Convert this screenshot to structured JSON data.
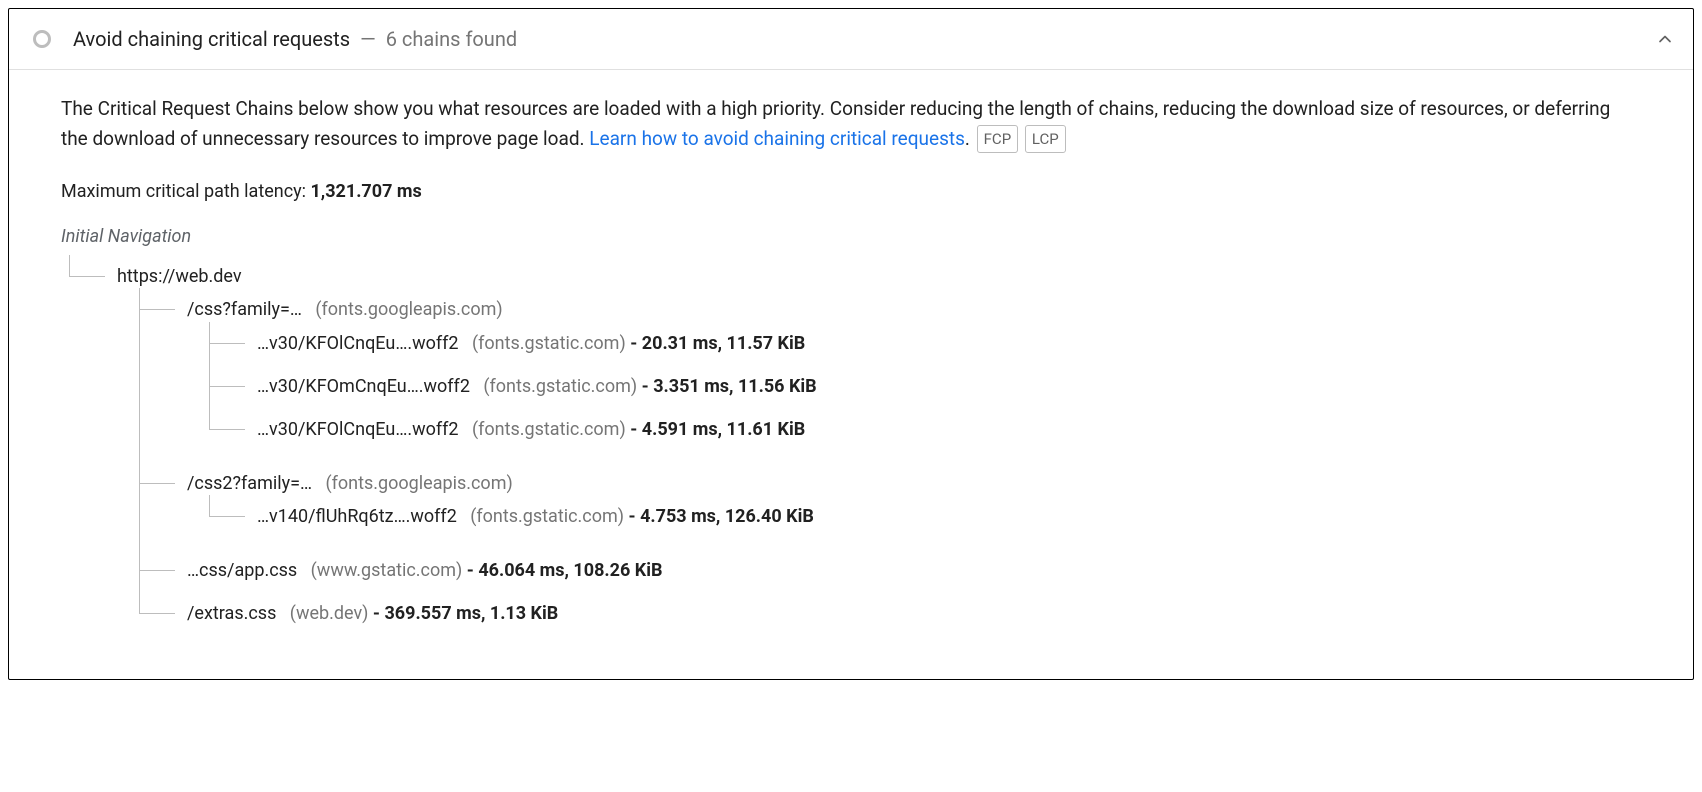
{
  "header": {
    "title": "Avoid chaining critical requests",
    "separator": "—",
    "summary": "6 chains found"
  },
  "description": {
    "text_before_link": "The Critical Request Chains below show you what resources are loaded with a high priority. Consider reducing the length of chains, reducing the download size of resources, or deferring the download of unnecessary resources to improve page load. ",
    "link_text": "Learn how to avoid chaining critical requests",
    "text_after_link": "."
  },
  "badges": [
    "FCP",
    "LCP"
  ],
  "latency": {
    "label": "Maximum critical path latency: ",
    "value": "1,321.707 ms"
  },
  "tree": {
    "root_label": "Initial Navigation",
    "nodes": {
      "n0": {
        "path": "https://web.dev",
        "host": "",
        "stats": ""
      },
      "n1": {
        "path": "/css?family=…",
        "host": "(fonts.googleapis.com)",
        "stats": ""
      },
      "n1a": {
        "path": "…v30/KFOlCnqEu….woff2",
        "host": "(fonts.gstatic.com)",
        "stats": "20.31 ms, 11.57 KiB"
      },
      "n1b": {
        "path": "…v30/KFOmCnqEu….woff2",
        "host": "(fonts.gstatic.com)",
        "stats": "3.351 ms, 11.56 KiB"
      },
      "n1c": {
        "path": "…v30/KFOlCnqEu….woff2",
        "host": "(fonts.gstatic.com)",
        "stats": "4.591 ms, 11.61 KiB"
      },
      "n2": {
        "path": "/css2?family=…",
        "host": "(fonts.googleapis.com)",
        "stats": ""
      },
      "n2a": {
        "path": "…v140/flUhRq6tz….woff2",
        "host": "(fonts.gstatic.com)",
        "stats": "4.753 ms, 126.40 KiB"
      },
      "n3": {
        "path": "…css/app.css",
        "host": "(www.gstatic.com)",
        "stats": "46.064 ms, 108.26 KiB"
      },
      "n4": {
        "path": "/extras.css",
        "host": "(web.dev)",
        "stats": "369.557 ms, 1.13 KiB"
      }
    }
  }
}
